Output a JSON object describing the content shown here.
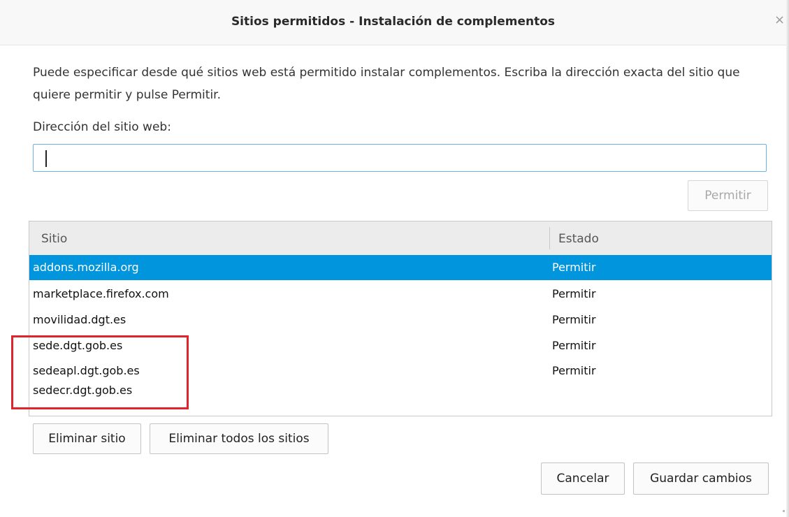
{
  "dialog": {
    "title": "Sitios permitidos - Instalación de complementos",
    "close_glyph": "×",
    "description": "Puede especificar desde qué sitios web está permitido instalar complementos. Escriba la dirección exacta del sitio que quiere permitir y pulse Permitir.",
    "address_label": "Dirección del sitio web:",
    "address_value": "",
    "allow_button": "Permitir"
  },
  "table": {
    "columns": [
      "Sitio",
      "Estado"
    ],
    "rows": [
      {
        "site": "addons.mozilla.org",
        "status": "Permitir",
        "selected": true
      },
      {
        "site": "marketplace.firefox.com",
        "status": "Permitir",
        "selected": false
      },
      {
        "site": "movilidad.dgt.es",
        "status": "Permitir",
        "selected": false
      },
      {
        "site": "sede.dgt.gob.es",
        "status": "Permitir",
        "selected": false
      },
      {
        "site": "sedeapl.dgt.gob.es",
        "status": "Permitir",
        "selected": false
      },
      {
        "site": "sedecr.dgt.gob.es",
        "status": "",
        "selected": false
      }
    ]
  },
  "buttons": {
    "remove_site": "Eliminar sitio",
    "remove_all": "Eliminar todos los sitios",
    "cancel": "Cancelar",
    "save": "Guardar cambios"
  },
  "colors": {
    "selection": "#0095dd",
    "annotation": "#e0242c",
    "focus_border": "#6fb2e6"
  }
}
